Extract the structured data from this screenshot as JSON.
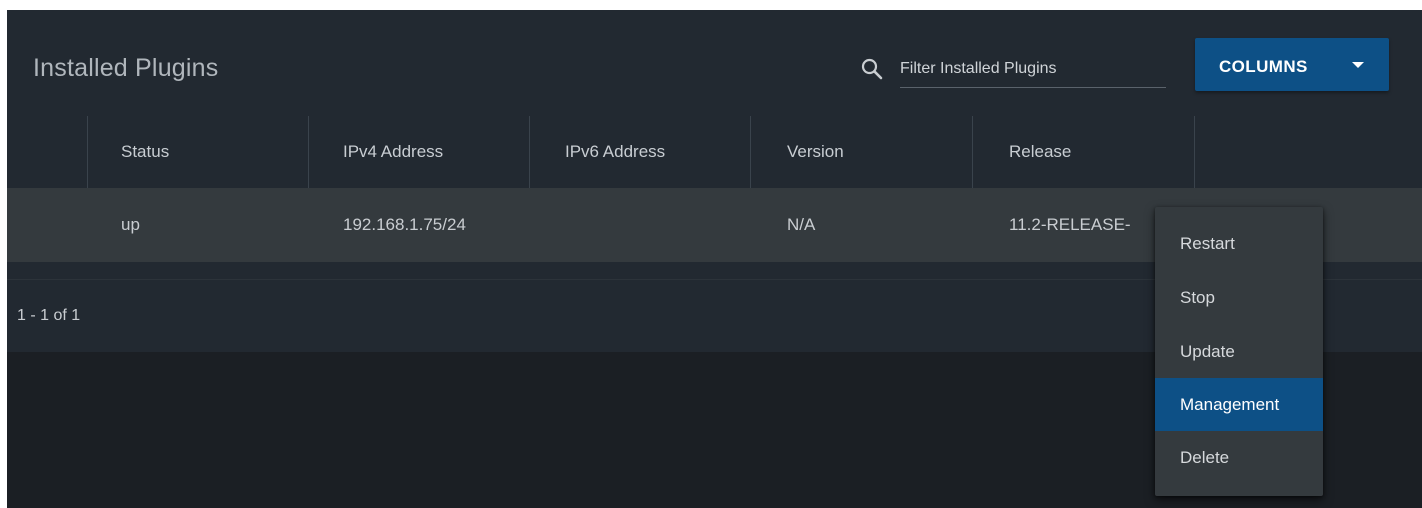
{
  "header": {
    "title": "Installed Plugins",
    "search": {
      "placeholder": "Filter Installed Plugins",
      "value": "",
      "icon": "search-icon"
    },
    "columns_button": {
      "label": "COLUMNS",
      "icon": "caret-down-icon"
    }
  },
  "table": {
    "columns": [
      "",
      "Status",
      "IPv4 Address",
      "IPv6 Address",
      "Version",
      "Release",
      ""
    ],
    "rows": [
      {
        "select": "",
        "status": "up",
        "ipv4": "192.168.1.75/24",
        "ipv6": "",
        "version": "N/A",
        "release": "11.2-RELEASE-"
      }
    ]
  },
  "footer": {
    "page_info": "1 - 1 of 1"
  },
  "action_menu": {
    "items": [
      {
        "label": "Restart",
        "active": false
      },
      {
        "label": "Stop",
        "active": false
      },
      {
        "label": "Update",
        "active": false
      },
      {
        "label": "Management",
        "active": true
      },
      {
        "label": "Delete",
        "active": false
      }
    ]
  },
  "colors": {
    "background": "#1b1f24",
    "card": "#222931",
    "row_highlight": "#343a3e",
    "accent": "#0d5086",
    "text": "#c9cdd1"
  }
}
